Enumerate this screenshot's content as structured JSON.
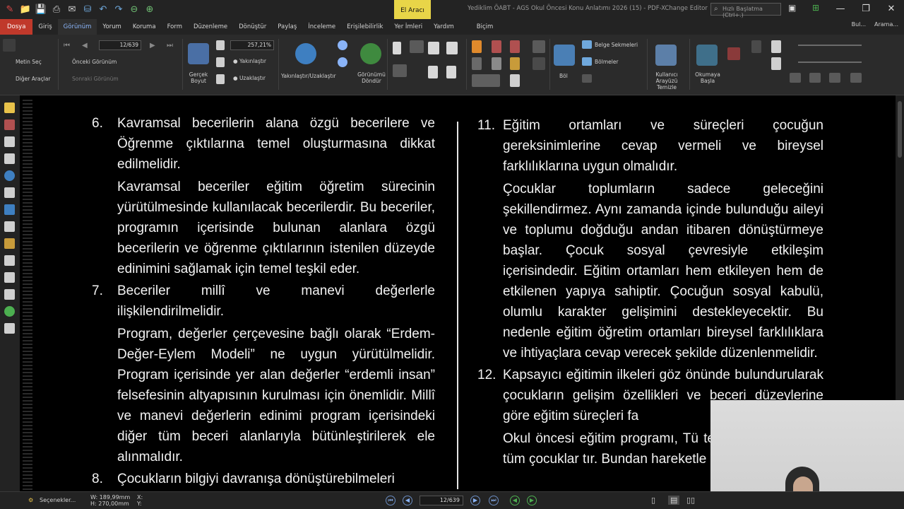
{
  "titlebar": {
    "doc_title": "Yediklim ÖABT - AGS  Okul Öncesi Konu Anlatımı 2026 (15) - PDF-XChange Editor",
    "context_tab": "El Aracı",
    "search_placeholder": "Hızlı Başlatma (Ctrl+.)",
    "minimize": "—",
    "restore": "❐",
    "close": "✕"
  },
  "tabs": [
    {
      "label": "Dosya"
    },
    {
      "label": "Giriş"
    },
    {
      "label": "Görünüm"
    },
    {
      "label": "Yorum"
    },
    {
      "label": "Koruma"
    },
    {
      "label": "Form"
    },
    {
      "label": "Düzenleme"
    },
    {
      "label": "Dönüştür"
    },
    {
      "label": "Paylaş"
    },
    {
      "label": "İnceleme"
    },
    {
      "label": "Erişilebilirlik"
    },
    {
      "label": "Yer İmleri"
    },
    {
      "label": "Yardım"
    },
    {
      "label": "Biçim"
    }
  ],
  "right_links": {
    "find": "Bul...",
    "search": "Arama..."
  },
  "ribbon": {
    "metin_sec": "Metin Seç",
    "diger_araclar": "Diğer Araçlar",
    "onceki_gorunum": "Önceki Görünüm",
    "sonraki_gorunum": "Sonraki Görünüm",
    "page_value": "12/639",
    "zoom_value": "257,21%",
    "gercek_boyut": "Gerçek Boyut",
    "yakinlastir": "Yakınlaştır",
    "uzaklastir": "Uzaklaştır",
    "yakinlastir_uzaklastir": "Yakınlaştır/Uzaklaştır",
    "gorunumu_dondur": "Görünümü Döndür",
    "bol": "Böl",
    "belge_sekmeleri": "Belge Sekmeleri",
    "bolmeler": "Bölmeler",
    "arayuz": "Kullanıcı Arayüzü Temizle",
    "okumaya_basla": "Okumaya Başla"
  },
  "document": {
    "left": [
      {
        "num": "6.",
        "heading": "Kavramsal becerilerin alana özgü becerilere ve Öğrenme çıktılarına temel oluşturmasına dikkat edilmelidir.",
        "body": "Kavramsal beceriler eğitim öğretim sürecinin yürütülmesinde kullanılacak becerilerdir. Bu beceriler, programın içerisinde bulunan alanlara özgü becerilerin ve öğrenme çıktılarının istenilen düzeyde edinimini sağlamak için temel teşkil eder."
      },
      {
        "num": "7.",
        "heading": "Beceriler millî ve manevi değerlerle ilişkilendirilmelidir.",
        "body": "Program, değerler çerçevesine bağlı olarak “Erdem-Değer-Eylem Modeli” ne uygun yürütülmelidir. Program içerisinde yer alan değerler “erdemli insan” felsefesinin altyapısının kurulması için önemlidir. Millî ve manevi değerlerin edinimi program içerisindeki diğer tüm beceri alanlarıyla bütünleştirilerek ele alınmalıdır."
      },
      {
        "num": "8.",
        "heading": "Çocukların bilgiyi davranışa dönüştürebilmeleri",
        "body": ""
      }
    ],
    "right": [
      {
        "num": "11.",
        "heading": "Eğitim ortamları ve süreçleri çocuğun gereksinimlerine cevap vermeli ve bireysel farklılıklarına uygun olmalıdır.",
        "body": "Çocuklar toplumların sadece geleceğini şekillendirmez. Aynı zamanda içinde bulunduğu aileyi ve toplumu doğduğu andan itibaren dönüştürmeye başlar. Çocuk sosyal çevresiyle etkileşim içerisindedir. Eğitim ortamları hem etkileyen hem de etkilenen yapıya sahiptir. Çocuğun sosyal kabulü, olumlu karakter gelişimini destekleyecektir. Bu nedenle eğitim öğretim ortamları bireysel farklılıklara ve ihtiyaçlara cevap verecek şekilde düzenlenmelidir."
      },
      {
        "num": "12.",
        "heading": "Kapsayıcı eğitimin ilkeleri göz önünde bulundurularak çocukların gelişim özellikleri ve beceri düzeylerine göre eğitim süreçleri fa",
        "body": "Okul öncesi eğitim programı, Tü temi içinde yer alan tüm çocuklar tır. Bundan hareketle çocukların"
      }
    ]
  },
  "statusbar": {
    "options": "Seçenekler...",
    "width": "W: 189,99mm",
    "height": "H: 270,00mm",
    "x": "X:",
    "y": "Y:",
    "page": "12/639"
  }
}
